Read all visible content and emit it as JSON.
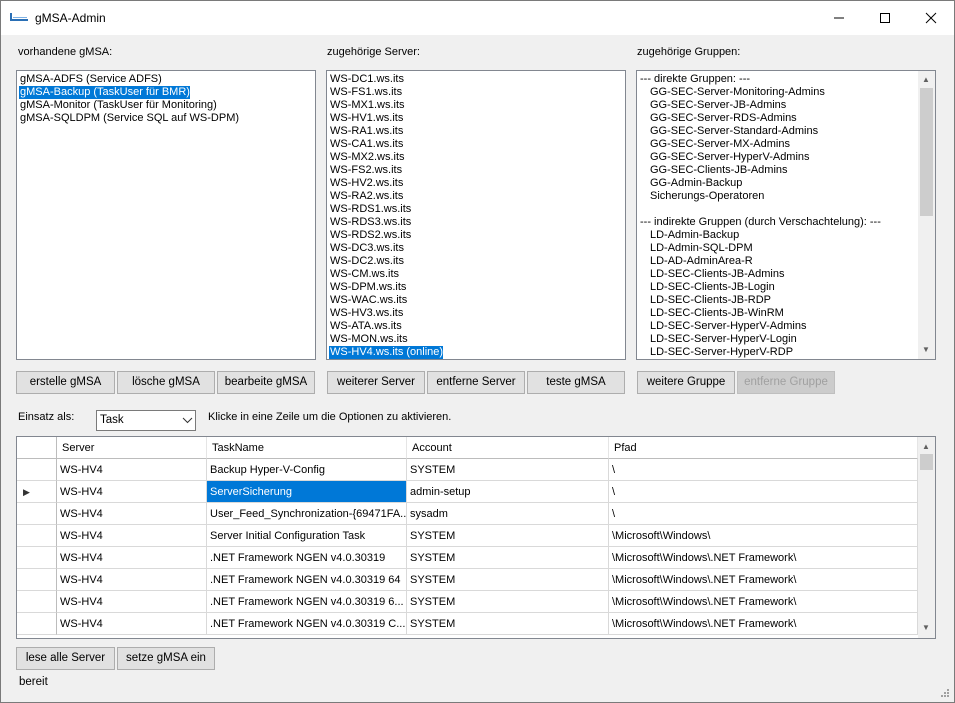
{
  "window": {
    "title": "gMSA-Admin",
    "controls": {
      "minimize": "–",
      "maximize": "☐",
      "close": "✕"
    }
  },
  "gmsa": {
    "label": "vorhandene gMSA:",
    "items": [
      "gMSA-ADFS (Service ADFS)",
      "gMSA-Backup (TaskUser für BMR)",
      "gMSA-Monitor (TaskUser für Monitoring)",
      "gMSA-SQLDPM (Service SQL auf WS-DPM)"
    ],
    "selected_index": 1,
    "buttons": {
      "create": "erstelle gMSA",
      "delete": "lösche gMSA",
      "edit": "bearbeite gMSA"
    }
  },
  "servers": {
    "label": "zugehörige Server:",
    "items": [
      "WS-DC1.ws.its",
      "WS-FS1.ws.its",
      "WS-MX1.ws.its",
      "WS-HV1.ws.its",
      "WS-RA1.ws.its",
      "WS-CA1.ws.its",
      "WS-MX2.ws.its",
      "WS-FS2.ws.its",
      "WS-HV2.ws.its",
      "WS-RA2.ws.its",
      "WS-RDS1.ws.its",
      "WS-RDS3.ws.its",
      "WS-RDS2.ws.its",
      "WS-DC3.ws.its",
      "WS-DC2.ws.its",
      "WS-CM.ws.its",
      "WS-DPM.ws.its",
      "WS-WAC.ws.its",
      "WS-HV3.ws.its",
      "WS-ATA.ws.its",
      "WS-MON.ws.its",
      "WS-HV4.ws.its (online)"
    ],
    "selected_index": 21,
    "buttons": {
      "add": "weiterer Server",
      "remove": "entferne Server",
      "test": "teste gMSA"
    }
  },
  "groups": {
    "label": "zugehörige Gruppen:",
    "items": [
      "--- direkte Gruppen: ---",
      "GG-SEC-Server-Monitoring-Admins",
      "GG-SEC-Server-JB-Admins",
      "GG-SEC-Server-RDS-Admins",
      "GG-SEC-Server-Standard-Admins",
      "GG-SEC-Server-MX-Admins",
      "GG-SEC-Server-HyperV-Admins",
      "GG-SEC-Clients-JB-Admins",
      "GG-Admin-Backup",
      "Sicherungs-Operatoren",
      "",
      "--- indirekte Gruppen (durch Verschachtelung): ---",
      "LD-Admin-Backup",
      "LD-Admin-SQL-DPM",
      "LD-AD-AdminArea-R",
      "LD-SEC-Clients-JB-Admins",
      "LD-SEC-Clients-JB-Login",
      "LD-SEC-Clients-JB-RDP",
      "LD-SEC-Clients-JB-WinRM",
      "LD-SEC-Server-HyperV-Admins",
      "LD-SEC-Server-HyperV-Login",
      "LD-SEC-Server-HyperV-RDP"
    ],
    "buttons": {
      "add": "weitere Gruppe",
      "remove": "entferne Gruppe"
    }
  },
  "usage": {
    "label": "Einsatz als:",
    "selected": "Task",
    "hint": "Klicke in eine Zeile um die Optionen zu aktivieren."
  },
  "table": {
    "columns": [
      "Server",
      "TaskName",
      "Account",
      "Pfad"
    ],
    "rows": [
      [
        "WS-HV4",
        "Backup Hyper-V-Config",
        "SYSTEM",
        "\\"
      ],
      [
        "WS-HV4",
        "ServerSicherung",
        "admin-setup",
        "\\"
      ],
      [
        "WS-HV4",
        "User_Feed_Synchronization-{69471FA...",
        "sysadm",
        "\\"
      ],
      [
        "WS-HV4",
        "Server Initial Configuration Task",
        "SYSTEM",
        "\\Microsoft\\Windows\\"
      ],
      [
        "WS-HV4",
        ".NET Framework NGEN v4.0.30319",
        "SYSTEM",
        "\\Microsoft\\Windows\\.NET Framework\\"
      ],
      [
        "WS-HV4",
        ".NET Framework NGEN v4.0.30319 64",
        "SYSTEM",
        "\\Microsoft\\Windows\\.NET Framework\\"
      ],
      [
        "WS-HV4",
        ".NET Framework NGEN v4.0.30319 6...",
        "SYSTEM",
        "\\Microsoft\\Windows\\.NET Framework\\"
      ],
      [
        "WS-HV4",
        ".NET Framework NGEN v4.0.30319 C...",
        "SYSTEM",
        "\\Microsoft\\Windows\\.NET Framework\\"
      ]
    ],
    "current_row_index": 1,
    "current_col_index": 1,
    "row_indicator": "▶"
  },
  "bottom_buttons": {
    "read_all": "lese alle Server",
    "apply": "setze gMSA ein"
  },
  "status": "bereit",
  "colors": {
    "selection": "#0078d7",
    "window_bg": "#f0f0f0"
  }
}
